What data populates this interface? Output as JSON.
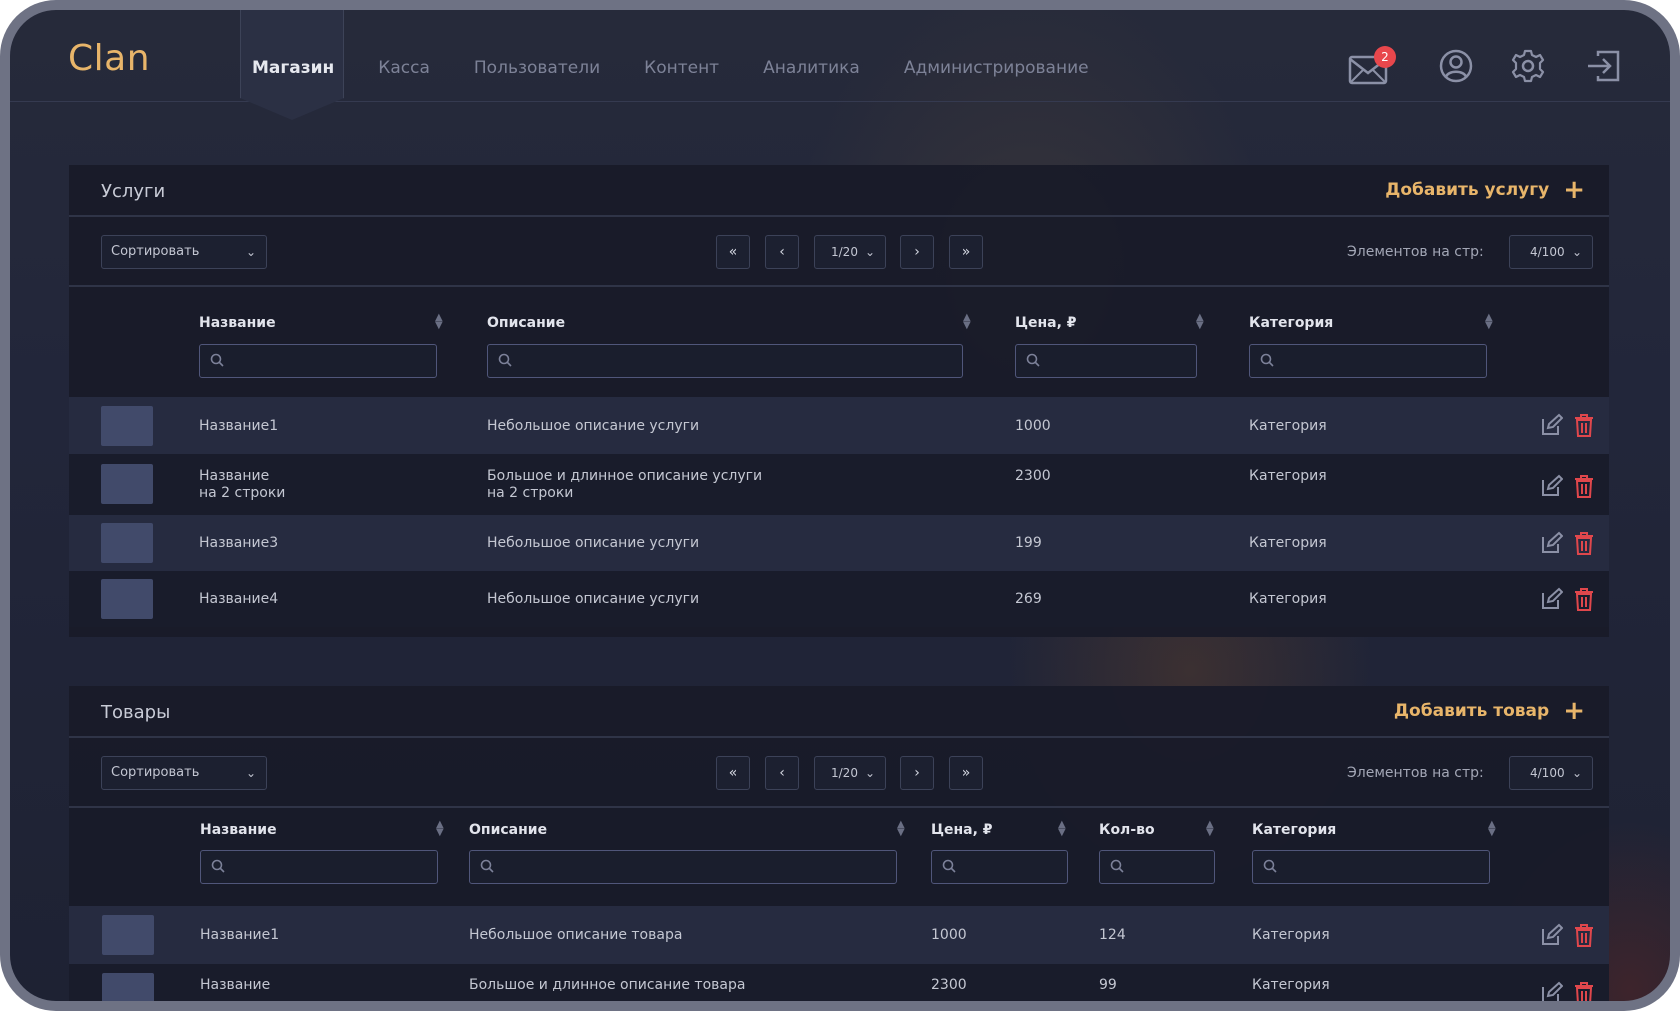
{
  "app": {
    "logo": "Clan"
  },
  "nav": {
    "items": [
      "Магазин",
      "Касса",
      "Пользователи",
      "Контент",
      "Аналитика",
      "Администрирование"
    ],
    "active": "Магазин"
  },
  "header": {
    "mail_badge": "2",
    "icons": [
      "mail-icon",
      "user-icon",
      "gear-icon",
      "logout-icon"
    ]
  },
  "services": {
    "title": "Услуги",
    "add_label": "Добавить услугу",
    "add_symbol": "+",
    "sort_label": "Сортировать",
    "pager": {
      "first": "«",
      "prev": "‹",
      "page": "1/20",
      "next": "›",
      "last": "»"
    },
    "per_page_label": "Элементов на стр:",
    "per_page_value": "4/100",
    "columns": [
      "Название",
      "Описание",
      "Цена, ₽",
      "Категория"
    ],
    "rows": [
      {
        "name": "Название1",
        "description": "Небольшое описание услуги",
        "price": "1000",
        "category": "Категория"
      },
      {
        "name": "Название\nна 2 строки",
        "description": "Большое и длинное описание услуги\nна 2 строки",
        "price": "2300",
        "category": "Категория"
      },
      {
        "name": "Название3",
        "description": "Небольшое описание услуги",
        "price": "199",
        "category": "Категория"
      },
      {
        "name": "Название4",
        "description": "Небольшое описание услуги",
        "price": "269",
        "category": "Категория"
      }
    ]
  },
  "goods": {
    "title": "Товары",
    "add_label": "Добавить товар",
    "add_symbol": "+",
    "sort_label": "Сортировать",
    "pager": {
      "first": "«",
      "prev": "‹",
      "page": "1/20",
      "next": "›",
      "last": "»"
    },
    "per_page_label": "Элементов на стр:",
    "per_page_value": "4/100",
    "columns": [
      "Название",
      "Описание",
      "Цена, ₽",
      "Кол-во",
      "Категория"
    ],
    "rows": [
      {
        "name": "Название1",
        "description": "Небольшое описание товара",
        "price": "1000",
        "qty": "124",
        "category": "Категория"
      },
      {
        "name": "Название",
        "description": "Большое и длинное описание товара",
        "price": "2300",
        "qty": "99",
        "category": "Категория"
      }
    ]
  },
  "colors": {
    "accent": "#e8b56a",
    "danger": "#e0474c",
    "badge": "#e8474c"
  }
}
